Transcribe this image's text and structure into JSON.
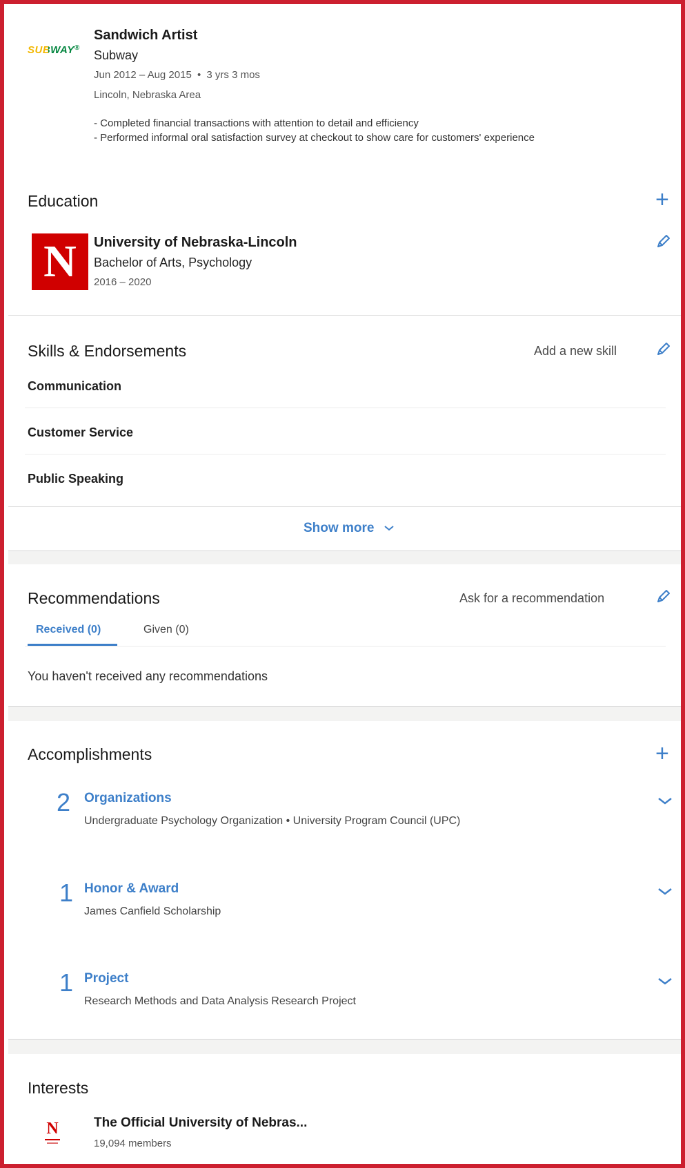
{
  "experience": {
    "logo_text": "SUBWAY",
    "title": "Sandwich Artist",
    "company": "Subway",
    "dates": "Jun 2012 – Aug 2015",
    "duration": "3 yrs 3 mos",
    "location": "Lincoln, Nebraska Area",
    "bullets": [
      "- Completed financial transactions with attention to detail and efficiency",
      "- Performed informal oral satisfaction survey at checkout to show care for customers' experience"
    ]
  },
  "education": {
    "heading": "Education",
    "logo_text": "N",
    "school": "University of Nebraska-Lincoln",
    "degree": "Bachelor of Arts, Psychology",
    "years": "2016 – 2020"
  },
  "skills": {
    "heading": "Skills & Endorsements",
    "add_label": "Add a new skill",
    "items": [
      "Communication",
      "Customer Service",
      "Public Speaking"
    ],
    "show_more": "Show more"
  },
  "recommendations": {
    "heading": "Recommendations",
    "ask_label": "Ask for a recommendation",
    "tabs": [
      "Received (0)",
      "Given (0)"
    ],
    "empty_text": "You haven't received any recommendations"
  },
  "accomplishments": {
    "heading": "Accomplishments",
    "items": [
      {
        "count": "2",
        "title": "Organizations",
        "detail": "Undergraduate Psychology Organization  •  University Program Council (UPC)"
      },
      {
        "count": "1",
        "title": "Honor & Award",
        "detail": "James Canfield Scholarship"
      },
      {
        "count": "1",
        "title": "Project",
        "detail": "Research Methods and Data Analysis Research Project"
      }
    ]
  },
  "interests": {
    "heading": "Interests",
    "logo_text": "N",
    "name": "The Official University of Nebras...",
    "members": "19,094 members"
  },
  "colors": {
    "accent": "#3d7fc9",
    "frame": "#cc1f2f",
    "nebraska_red": "#d00000",
    "subway_yellow": "#f2b700",
    "subway_green": "#00843d"
  }
}
